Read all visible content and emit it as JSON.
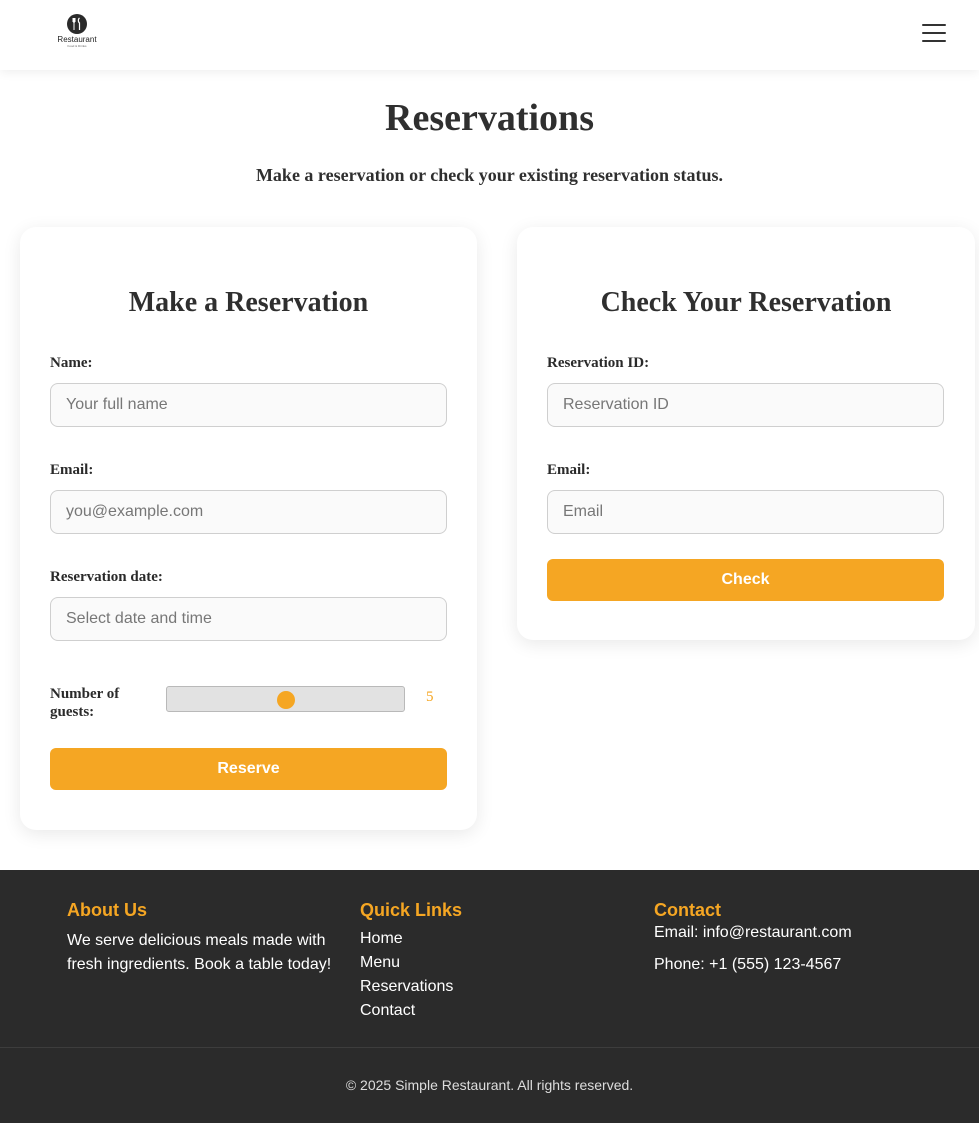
{
  "header": {
    "logo_name": "Restaurant",
    "logo_tagline": "Food & Drinks",
    "menu_icon": "hamburger-menu-icon"
  },
  "hero": {
    "title": "Reservations",
    "subtitle": "Make a reservation or check your existing reservation status."
  },
  "reserve_form": {
    "title": "Make a Reservation",
    "name_label": "Name:",
    "name_placeholder": "Your full name",
    "email_label": "Email:",
    "email_placeholder": "you@example.com",
    "date_label": "Reservation date:",
    "date_placeholder": "Select date and time",
    "guests_label": "Number of guests:",
    "guests_value": "5",
    "guests_level": 0.5,
    "submit_label": "Reserve"
  },
  "check_form": {
    "title": "Check Your Reservation",
    "id_label": "Reservation ID:",
    "id_placeholder": "Reservation ID",
    "email_label": "Email:",
    "email_placeholder": "Email",
    "submit_label": "Check"
  },
  "footer": {
    "about": {
      "heading": "About Us",
      "text": "We serve delicious meals made with fresh ingredients. Book a table today!"
    },
    "quick_links": {
      "heading": "Quick Links",
      "links": [
        "Home",
        "Menu",
        "Reservations",
        "Contact"
      ]
    },
    "contact": {
      "heading": "Contact",
      "email": "Email: info@restaurant.com",
      "phone": "Phone: +1 (555) 123-4567"
    },
    "copyright": "© 2025 Simple Restaurant. All rights reserved."
  },
  "colors": {
    "accent": "#f5a623",
    "footer_bg": "#2b2b2b",
    "text": "#2f2f2f"
  }
}
